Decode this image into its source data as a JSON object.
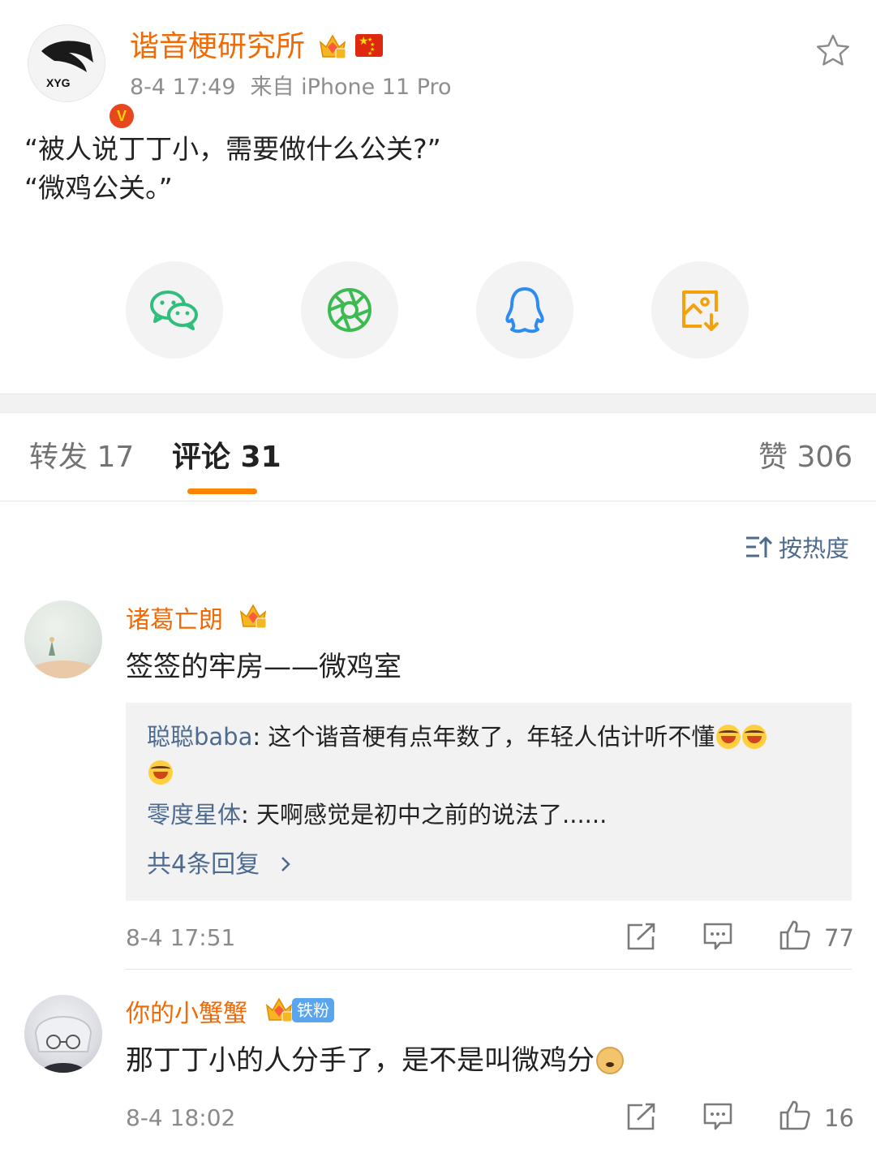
{
  "post": {
    "author_name": "谐音梗研究所",
    "avatar_text": "XYG",
    "verified_mark": "V",
    "time": "8-4 17:49",
    "source": "来自 iPhone 11 Pro",
    "text_line1": "“被人说丁丁小，需要做什么公关?”",
    "text_line2": "“微鸡公关。”"
  },
  "share": {
    "items": [
      "wechat-icon",
      "moments-icon",
      "qq-icon",
      "save-image-icon"
    ]
  },
  "tabs": {
    "repost": "转发 17",
    "comments": "评论 31",
    "likes": "赞 306"
  },
  "sort": {
    "label": "按热度"
  },
  "comments": [
    {
      "name": "诸葛亡朗",
      "text": "签签的牢房——微鸡室",
      "replies": [
        {
          "author": "聪聪baba",
          "text": ": 这个谐音梗有点年数了，年轻人估计听不懂"
        },
        {
          "author": "零度星体",
          "text": ": 天啊感觉是初中之前的说法了......"
        }
      ],
      "more_replies": "共4条回复",
      "time": "8-4 17:51",
      "likes": "77"
    },
    {
      "name": "你的小蟹蟹",
      "badge": "铁粉",
      "text": "那丁丁小的人分手了，是不是叫微鸡分",
      "time": "8-4 18:02",
      "likes": "16"
    }
  ],
  "colors": {
    "brand_orange": "#ff8200",
    "name_orange": "#f06a05",
    "link_blue": "#4d6a8f"
  }
}
